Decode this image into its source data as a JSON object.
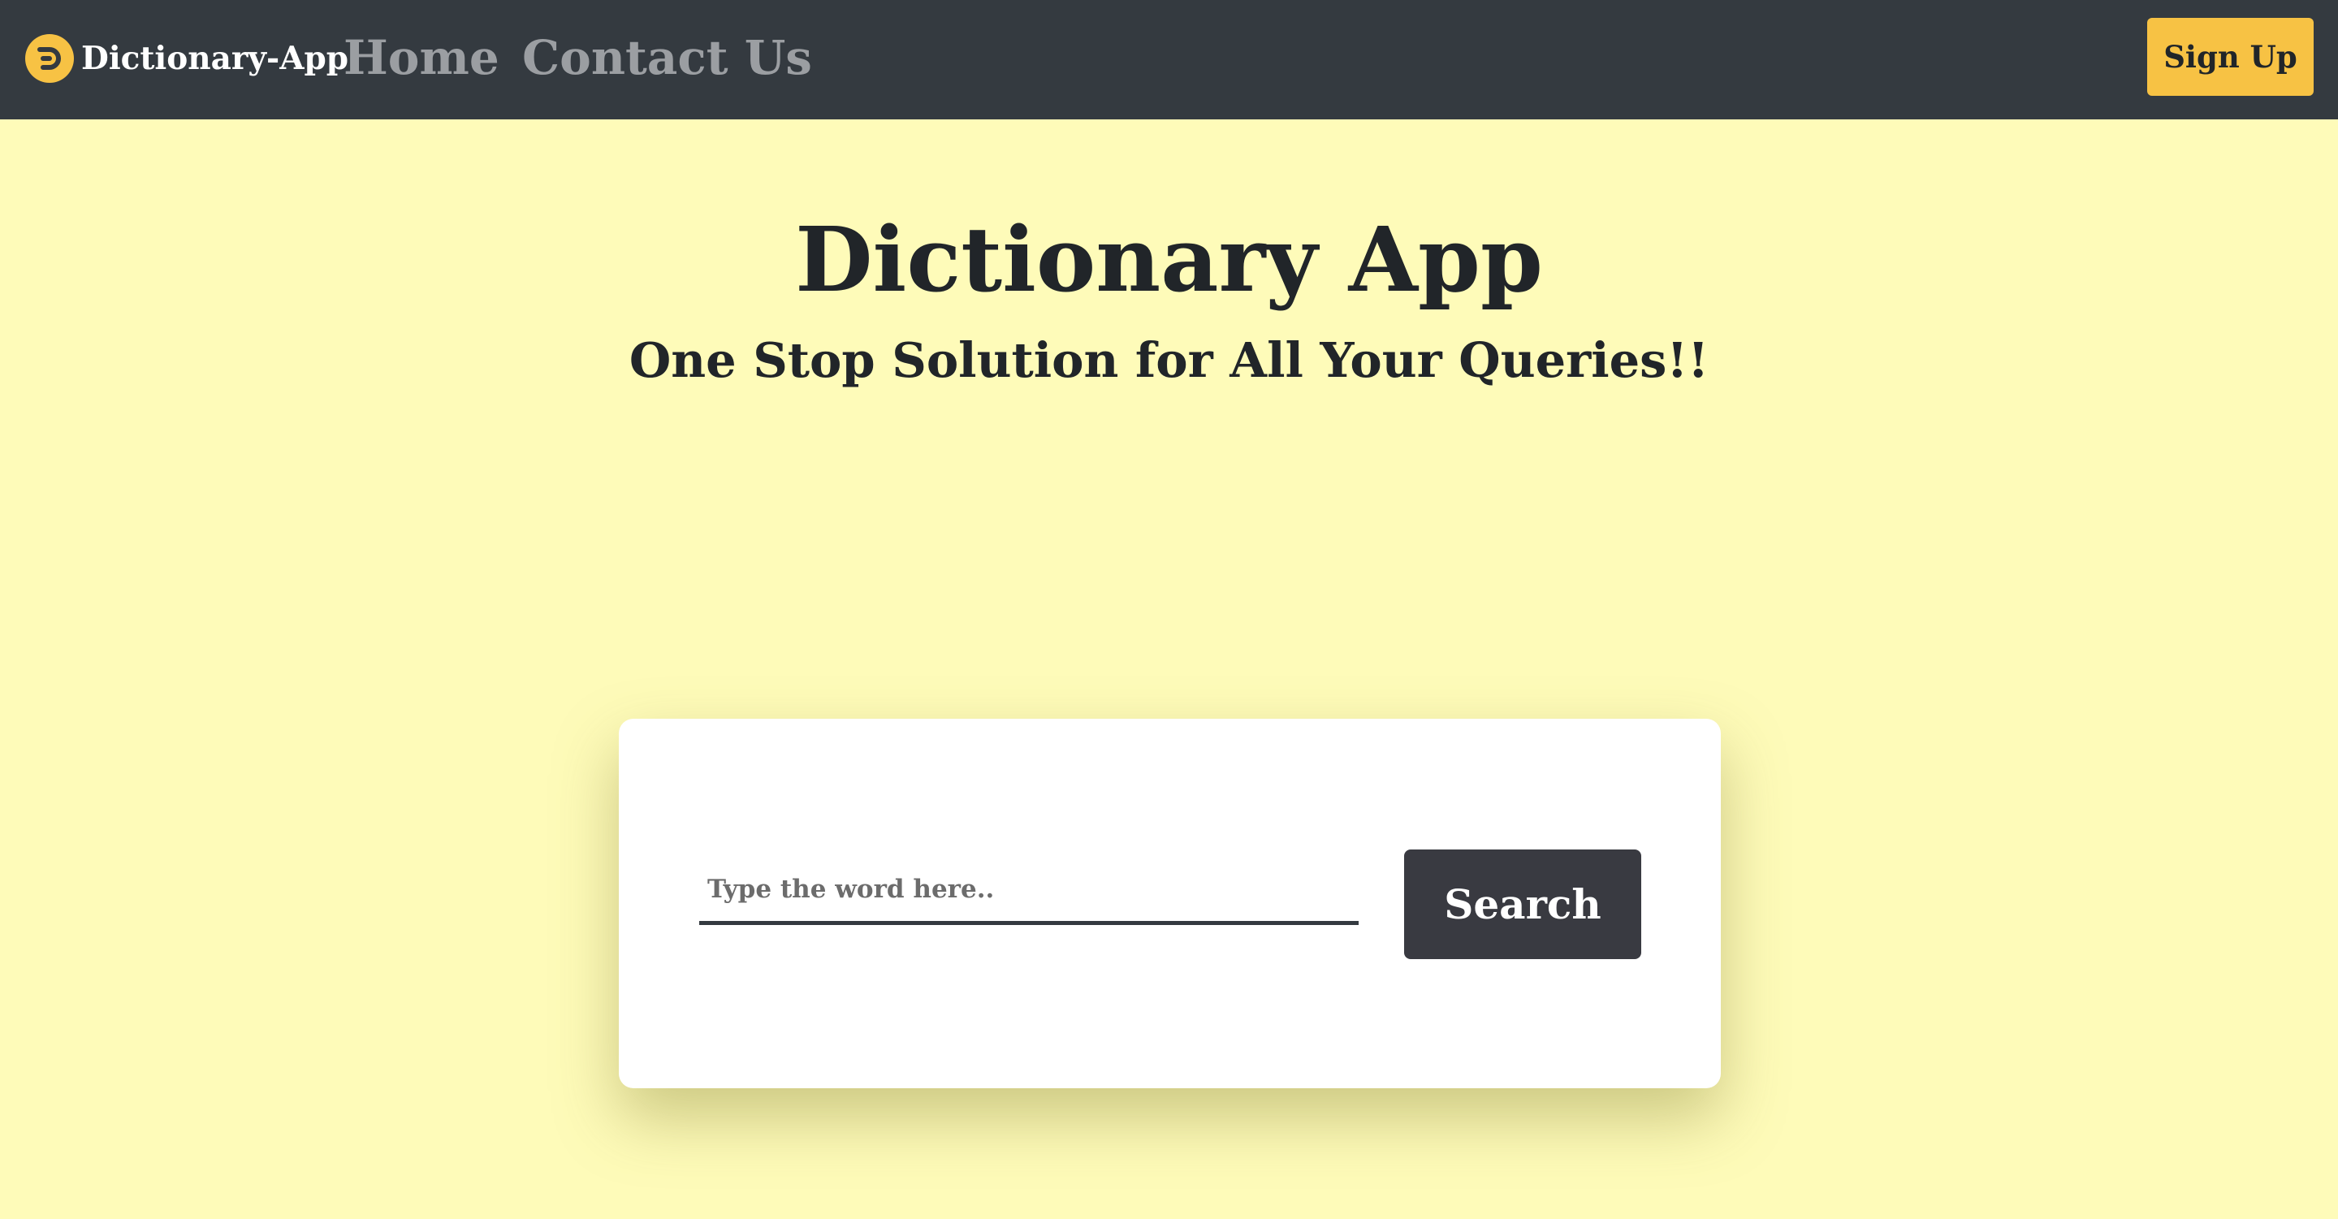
{
  "navbar": {
    "brand": "Dictionary-App",
    "brand_icon": "dictionary-logo-icon",
    "links": [
      {
        "label": "Home"
      },
      {
        "label": "Contact Us"
      }
    ],
    "signup_label": "Sign Up"
  },
  "hero": {
    "title": "Dictionary App",
    "subtitle": "One Stop Solution for All Your Queries!!"
  },
  "search": {
    "placeholder": "Type the word here..",
    "value": "",
    "button_label": "Search"
  },
  "colors": {
    "background": "#fefbb9",
    "navbar": "#343a40",
    "accent": "#f7c244",
    "search_button": "#393a41",
    "card": "#ffffff"
  }
}
